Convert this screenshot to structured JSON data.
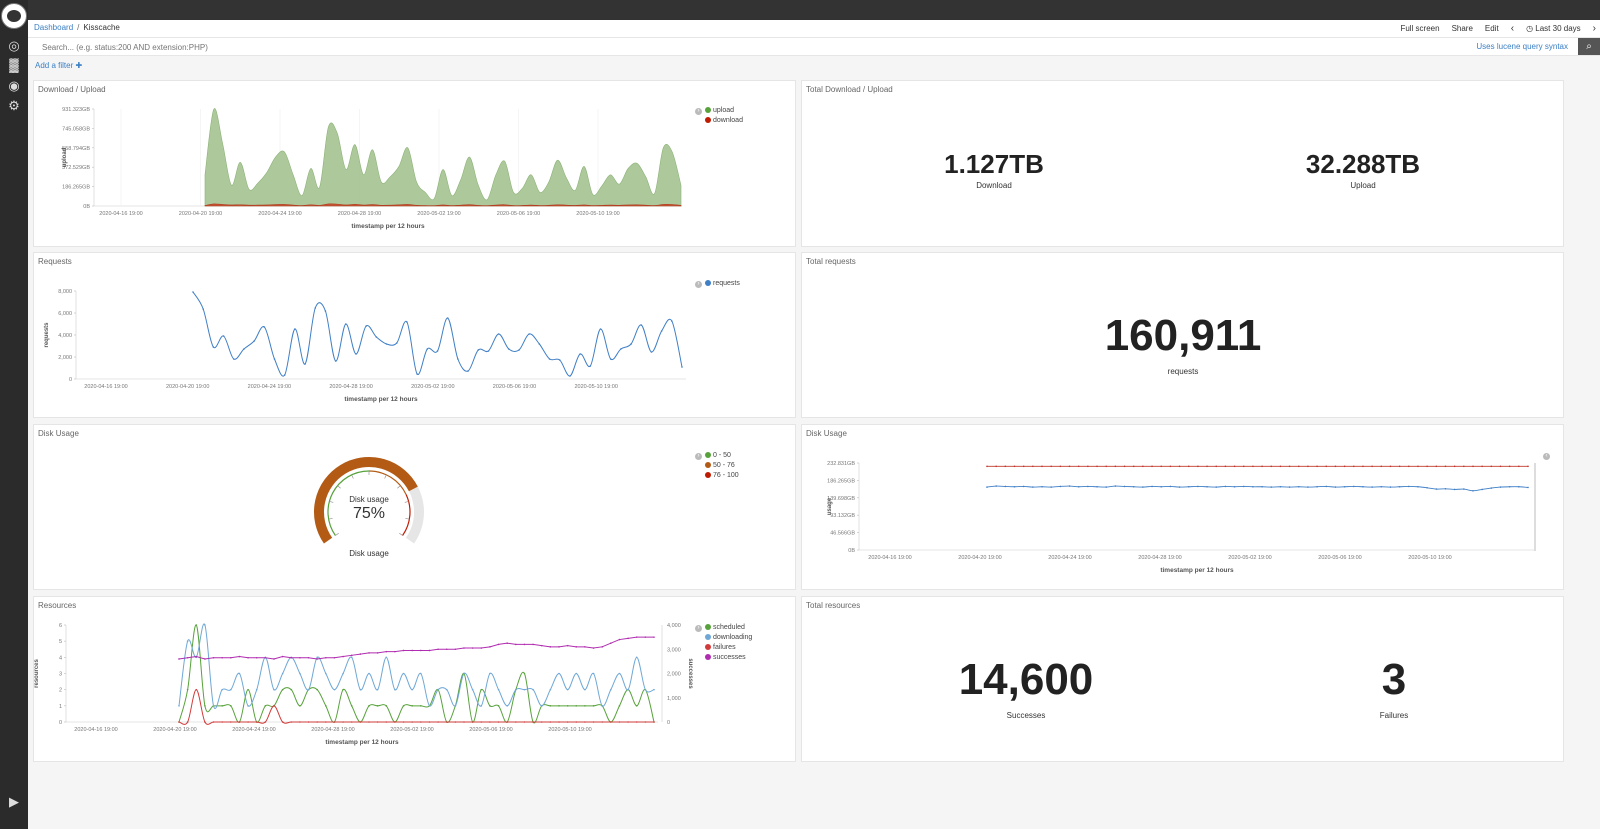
{
  "breadcrumb": {
    "root": "Dashboard",
    "current": "Kisscache"
  },
  "topnav": {
    "fullscreen": "Full screen",
    "share": "Share",
    "edit": "Edit",
    "timerange": "Last 30 days"
  },
  "search": {
    "placeholder": "Search... (e.g. status:200 AND extension:PHP)",
    "syntax_link": "Uses lucene query syntax"
  },
  "filter": {
    "add_label": "Add a filter"
  },
  "panels": {
    "download_upload": {
      "title": "Download / Upload",
      "xlabel": "timestamp per 12 hours",
      "ylabel": "upload",
      "yticks": [
        "931.323GB",
        "745.058GB",
        "558.794GB",
        "372.529GB",
        "186.265GB",
        "0B"
      ],
      "xticks": [
        "2020-04-16 19:00",
        "2020-04-20 19:00",
        "2020-04-24 19:00",
        "2020-04-28 19:00",
        "2020-05-02 19:00",
        "2020-05-06 19:00",
        "2020-05-10 19:00"
      ],
      "legend": [
        {
          "label": "upload",
          "color": "#57a23b"
        },
        {
          "label": "download",
          "color": "#bf1b00"
        }
      ]
    },
    "total_download_upload": {
      "title": "Total Download / Upload",
      "download_value": "1.127TB",
      "download_label": "Download",
      "upload_value": "32.288TB",
      "upload_label": "Upload"
    },
    "requests": {
      "title": "Requests",
      "xlabel": "timestamp per 12 hours",
      "ylabel": "requests",
      "yticks": [
        "8,000",
        "6,000",
        "4,000",
        "2,000",
        "0"
      ],
      "xticks": [
        "2020-04-16 19:00",
        "2020-04-20 19:00",
        "2020-04-24 19:00",
        "2020-04-28 19:00",
        "2020-05-02 19:00",
        "2020-05-06 19:00",
        "2020-05-10 19:00"
      ],
      "legend": [
        {
          "label": "requests",
          "color": "#3f7fc6"
        }
      ]
    },
    "total_requests": {
      "title": "Total requests",
      "value": "160,911",
      "label": "requests"
    },
    "disk_gauge": {
      "title": "Disk Usage",
      "inner_label": "Disk usage",
      "value_text": "75%",
      "caption": "Disk usage",
      "value_pct": 75,
      "legend": [
        {
          "label": "0 - 50",
          "color": "#57a23b"
        },
        {
          "label": "50 - 76",
          "color": "#b35b14"
        },
        {
          "label": "76 - 100",
          "color": "#bf1b00"
        }
      ]
    },
    "disk_usage_line": {
      "title": "Disk Usage",
      "xlabel": "timestamp per 12 hours",
      "ylabel": "usage",
      "yticks": [
        "232.831GB",
        "186.265GB",
        "139.698GB",
        "93.132GB",
        "46.566GB",
        "0B"
      ],
      "xticks": [
        "2020-04-16 19:00",
        "2020-04-20 19:00",
        "2020-04-24 19:00",
        "2020-04-28 19:00",
        "2020-05-02 19:00",
        "2020-05-06 19:00",
        "2020-05-10 19:00"
      ]
    },
    "resources": {
      "title": "Resources",
      "xlabel": "timestamp per 12 hours",
      "ylabel": "resources",
      "y2label": "successes",
      "yticks": [
        "6",
        "5",
        "4",
        "3",
        "2",
        "1",
        "0"
      ],
      "y2ticks": [
        "4,000",
        "3,000",
        "2,000",
        "1,000",
        "0"
      ],
      "xticks": [
        "2020-04-16 19:00",
        "2020-04-20 19:00",
        "2020-04-24 19:00",
        "2020-04-28 19:00",
        "2020-05-02 19:00",
        "2020-05-06 19:00",
        "2020-05-10 19:00"
      ],
      "legend": [
        {
          "label": "scheduled",
          "color": "#57a23b"
        },
        {
          "label": "downloading",
          "color": "#6fa8d6"
        },
        {
          "label": "failures",
          "color": "#d23b3b"
        },
        {
          "label": "successes",
          "color": "#b02cb0"
        }
      ]
    },
    "total_resources": {
      "title": "Total resources",
      "successes_value": "14,600",
      "successes_label": "Successes",
      "failures_value": "3",
      "failures_label": "Failures"
    }
  },
  "chart_data": [
    {
      "type": "area",
      "x_start": "2020-04-20 19:00",
      "interval": "12h",
      "series": [
        {
          "name": "upload",
          "values": [
            300,
            930,
            600,
            200,
            420,
            160,
            220,
            320,
            470,
            520,
            300,
            100,
            360,
            180,
            760,
            700,
            350,
            590,
            300,
            540,
            230,
            280,
            380,
            560,
            230,
            130,
            70,
            350,
            100,
            250,
            470,
            200,
            60,
            300,
            430,
            130,
            170,
            300,
            130,
            230,
            440,
            270,
            150,
            380,
            110,
            190,
            300,
            210,
            360,
            410,
            280,
            120,
            560,
            520,
            200
          ]
        },
        {
          "name": "download",
          "values": [
            5,
            20,
            15,
            10,
            12,
            8,
            9,
            10,
            14,
            15,
            9,
            4,
            12,
            6,
            20,
            18,
            10,
            16,
            9,
            14,
            7,
            8,
            11,
            15,
            7,
            4,
            3,
            10,
            4,
            8,
            13,
            6,
            3,
            9,
            12,
            4,
            5,
            9,
            4,
            7,
            12,
            8,
            5,
            10,
            4,
            6,
            9,
            7,
            10,
            11,
            8,
            4,
            15,
            14,
            6
          ]
        }
      ],
      "ylim": [
        0,
        931.323
      ],
      "yunit": "GB"
    },
    {
      "type": "line",
      "x_start": "2020-04-20 19:00",
      "interval": "12h",
      "series": [
        {
          "name": "requests",
          "values": [
            8700,
            7000,
            3200,
            4300,
            2000,
            3000,
            3800,
            5200,
            2000,
            400,
            5000,
            1500,
            7100,
            6800,
            1800,
            5500,
            2500,
            5300,
            4200,
            3500,
            3600,
            5700,
            500,
            3000,
            2800,
            6100,
            2000,
            800,
            2900,
            2800,
            4500,
            3000,
            2900,
            4500,
            3500,
            2000,
            1900,
            300,
            2500,
            1300,
            5000,
            2000,
            3000,
            3500,
            5400,
            2700,
            4800,
            5800,
            1200
          ]
        }
      ]
    },
    {
      "type": "line",
      "x_start": "2020-04-20 19:00",
      "interval": "12h",
      "series": [
        {
          "name": "max",
          "values": [
            250,
            250,
            250,
            250,
            250,
            250,
            250,
            250,
            250,
            250,
            250,
            250,
            250,
            250,
            250,
            250,
            250,
            250,
            250,
            250,
            250,
            250,
            250,
            250,
            250,
            250,
            250,
            250,
            250,
            250,
            250,
            250,
            250,
            250,
            250,
            250,
            250,
            250,
            250,
            250,
            250,
            250,
            250,
            250,
            250,
            250,
            250,
            250,
            250,
            250,
            250,
            250,
            250,
            250,
            250,
            250,
            250,
            250,
            250,
            250
          ]
        },
        {
          "name": "usage",
          "values": [
            188,
            191,
            190,
            189,
            190,
            188,
            189,
            188,
            190,
            191,
            189,
            190,
            189,
            188,
            191,
            190,
            189,
            188,
            190,
            189,
            190,
            188,
            189,
            190,
            189,
            188,
            190,
            189,
            190,
            189,
            189,
            188,
            189,
            188,
            189,
            188,
            189,
            190,
            188,
            189,
            190,
            189,
            188,
            189,
            188,
            189,
            190,
            189,
            186,
            182,
            183,
            181,
            182,
            177,
            181,
            185,
            188,
            189,
            189,
            187
          ]
        }
      ]
    },
    {
      "type": "line",
      "x_start": "2020-04-20 19:00",
      "interval": "12h",
      "series": [
        {
          "name": "scheduled",
          "axis": "left",
          "values": [
            0,
            2,
            6,
            1,
            1,
            1,
            1,
            0,
            2,
            0,
            1,
            1,
            2,
            2,
            1,
            2,
            2,
            1,
            0,
            2,
            1,
            0,
            1,
            1,
            1,
            0,
            1,
            1,
            1,
            1,
            2,
            0,
            1,
            3,
            0,
            2,
            1,
            1,
            0,
            2,
            3,
            0,
            1,
            1,
            1,
            1,
            1,
            1,
            1,
            1,
            0,
            1,
            2,
            1,
            2,
            0
          ]
        },
        {
          "name": "downloading",
          "axis": "left",
          "values": [
            1,
            5,
            4,
            6,
            1,
            2,
            2,
            3,
            1,
            2,
            4,
            2,
            3,
            4,
            3,
            2,
            4,
            3,
            2,
            3,
            4,
            2,
            3,
            2,
            4,
            2,
            3,
            2,
            3,
            1,
            2,
            2,
            1,
            3,
            2,
            1,
            3,
            2,
            1,
            2,
            2,
            2,
            1,
            2,
            3,
            2,
            3,
            2,
            3,
            1,
            2,
            3,
            2,
            4,
            2,
            2
          ]
        },
        {
          "name": "failures",
          "axis": "left",
          "values": [
            0,
            0,
            2,
            0,
            0,
            0,
            0,
            0,
            0,
            0,
            0,
            1,
            0,
            0,
            0,
            0,
            0,
            0,
            0,
            0,
            0,
            0,
            0,
            0,
            0,
            0,
            0,
            0,
            0,
            0,
            0,
            0,
            0,
            0,
            0,
            0,
            0,
            0,
            0,
            0,
            0,
            0,
            0,
            0,
            0,
            0,
            0,
            0,
            0,
            0,
            0,
            0,
            0,
            0,
            0,
            0
          ]
        },
        {
          "name": "successes",
          "axis": "right",
          "values": [
            2600,
            2650,
            2700,
            2600,
            2650,
            2650,
            2650,
            2700,
            2650,
            2650,
            2650,
            2600,
            2700,
            2650,
            2650,
            2650,
            2600,
            2650,
            2650,
            2700,
            2750,
            2800,
            2850,
            2850,
            2900,
            2900,
            2950,
            2950,
            2950,
            2950,
            3000,
            3000,
            3000,
            3050,
            3050,
            3050,
            3100,
            3200,
            3250,
            3200,
            3200,
            3200,
            3150,
            3100,
            3100,
            3150,
            3100,
            3100,
            3050,
            3100,
            3250,
            3400,
            3450,
            3500,
            3500,
            3500
          ]
        }
      ],
      "ylim": [
        0,
        6
      ],
      "y2lim": [
        0,
        4000
      ]
    },
    {
      "type": "gauge",
      "value": 75,
      "ranges": [
        [
          0,
          50
        ],
        [
          50,
          76
        ],
        [
          76,
          100
        ]
      ]
    }
  ]
}
